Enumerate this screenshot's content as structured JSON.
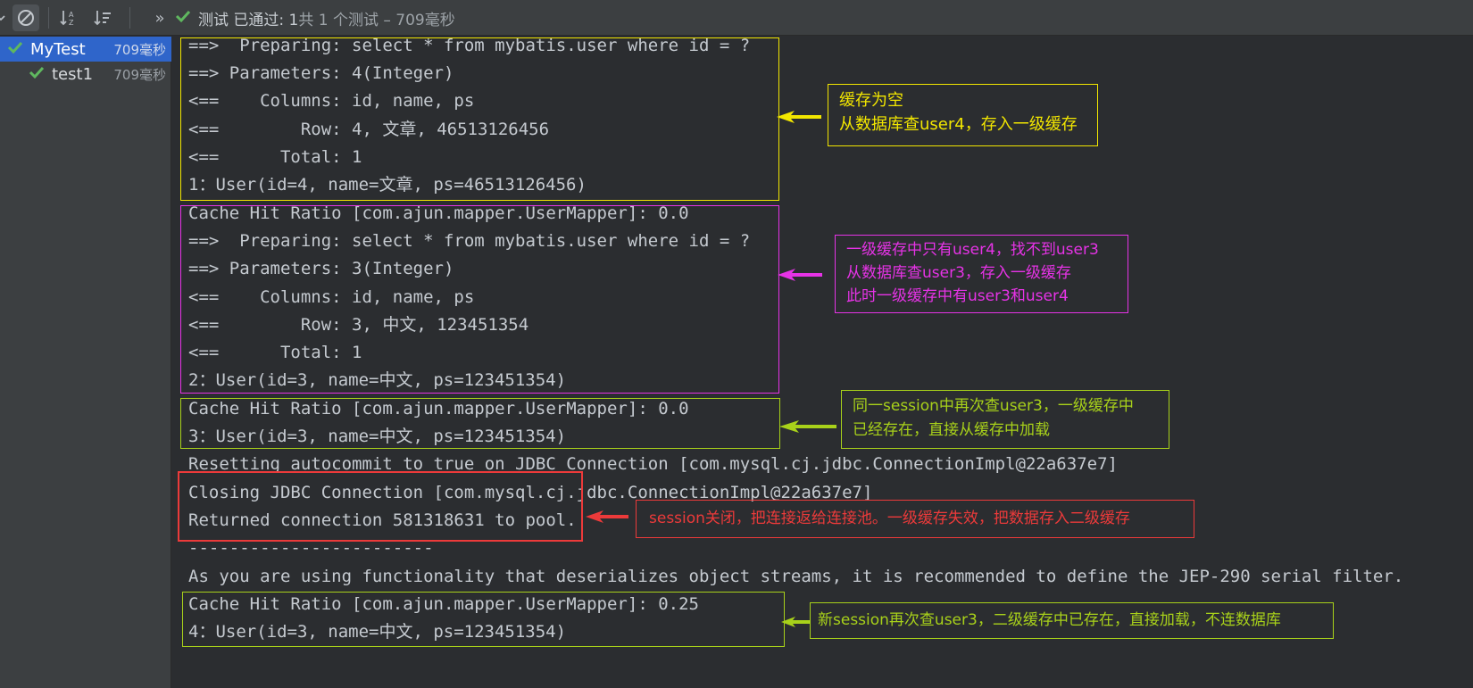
{
  "toolbar": {
    "status_passed": "测试 已通过: 1",
    "status_count": "共 1 个测试 – 709毫秒",
    "more_label": "»"
  },
  "tree": {
    "items": [
      {
        "label": "MyTest",
        "time": "709毫秒",
        "selected": true
      },
      {
        "label": "test1",
        "time": "709毫秒",
        "selected": false
      }
    ]
  },
  "console": {
    "lines": [
      "==>  Preparing: select * from mybatis.user where id = ?",
      "==> Parameters: 4(Integer)",
      "<==    Columns: id, name, ps",
      "<==        Row: 4, 文章, 46513126456",
      "<==      Total: 1",
      "1：User(id=4, name=文章, ps=46513126456)",
      "Cache Hit Ratio [com.ajun.mapper.UserMapper]: 0.0",
      "==>  Preparing: select * from mybatis.user where id = ?",
      "==> Parameters: 3(Integer)",
      "<==    Columns: id, name, ps",
      "<==        Row: 3, 中文, 123451354",
      "<==      Total: 1",
      "2：User(id=3, name=中文, ps=123451354)",
      "Cache Hit Ratio [com.ajun.mapper.UserMapper]: 0.0",
      "3：User(id=3, name=中文, ps=123451354)",
      "Resetting autocommit to true on JDBC Connection [com.mysql.cj.jdbc.ConnectionImpl@22a637e7]",
      "Closing JDBC Connection [com.mysql.cj.jdbc.ConnectionImpl@22a637e7]",
      "Returned connection 581318631 to pool.",
      "------------------------",
      "As you are using functionality that deserializes object streams, it is recommended to define the JEP-290 serial filter.",
      "Cache Hit Ratio [com.ajun.mapper.UserMapper]: 0.25",
      "4：User(id=3, name=中文, ps=123451354)"
    ]
  },
  "annotations": [
    {
      "lines": [
        "缓存为空",
        "从数据库查user4，存入一级缓存"
      ],
      "color": "#f2e600"
    },
    {
      "lines": [
        "一级缓存中只有user4，找不到user3",
        "从数据库查user3，存入一级缓存",
        "此时一级缓存中有user3和user4"
      ],
      "color": "#e633e6"
    },
    {
      "lines": [
        "同一session中再次查user3，一级缓存中",
        "已经存在，直接从缓存中加载"
      ],
      "color": "#a8d11a"
    },
    {
      "lines": [
        "session关闭，把连接返给连接池。一级缓存失效，把数据存入二级缓存"
      ],
      "color": "#ec3a3a"
    },
    {
      "lines": [
        "新session再次查user3，二级缓存中已存在，直接加载，不连数据库"
      ],
      "color": "#a8d11a"
    }
  ]
}
